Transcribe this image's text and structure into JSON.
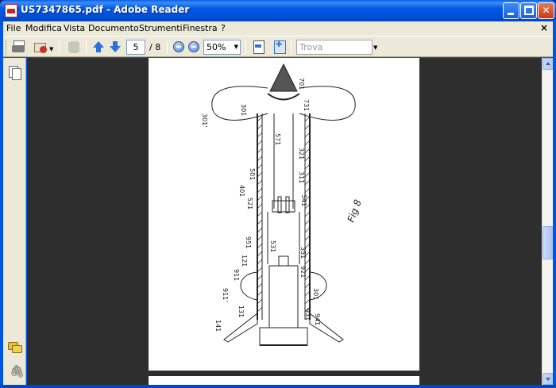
{
  "window": {
    "title": "US7347865.pdf - Adobe Reader",
    "minimize_glyph": "",
    "close_glyph": "✕"
  },
  "menu": {
    "items": [
      "File",
      "Modifica",
      "Vista",
      "Documento",
      "Strumenti",
      "Finestra",
      "?"
    ],
    "close_glyph": "×"
  },
  "toolbar": {
    "current_page": "5",
    "page_total": "/ 8",
    "zoom": "50%",
    "search_placeholder": "Trova",
    "dropdown_glyph": "▼"
  },
  "sidebar": {
    "icons": [
      "pages-icon",
      "comments-icon",
      "attachments-icon"
    ],
    "clip_glyph": "🖇"
  },
  "drawing": {
    "figure_label": "Fig 8",
    "labels": [
      "701",
      "301",
      "731",
      "301'",
      "571",
      "321",
      "501",
      "311",
      "401",
      "521",
      "541",
      "531",
      "951",
      "121",
      "351",
      "911",
      "921",
      "911'",
      "301",
      "131",
      "931",
      "141",
      "941"
    ]
  }
}
